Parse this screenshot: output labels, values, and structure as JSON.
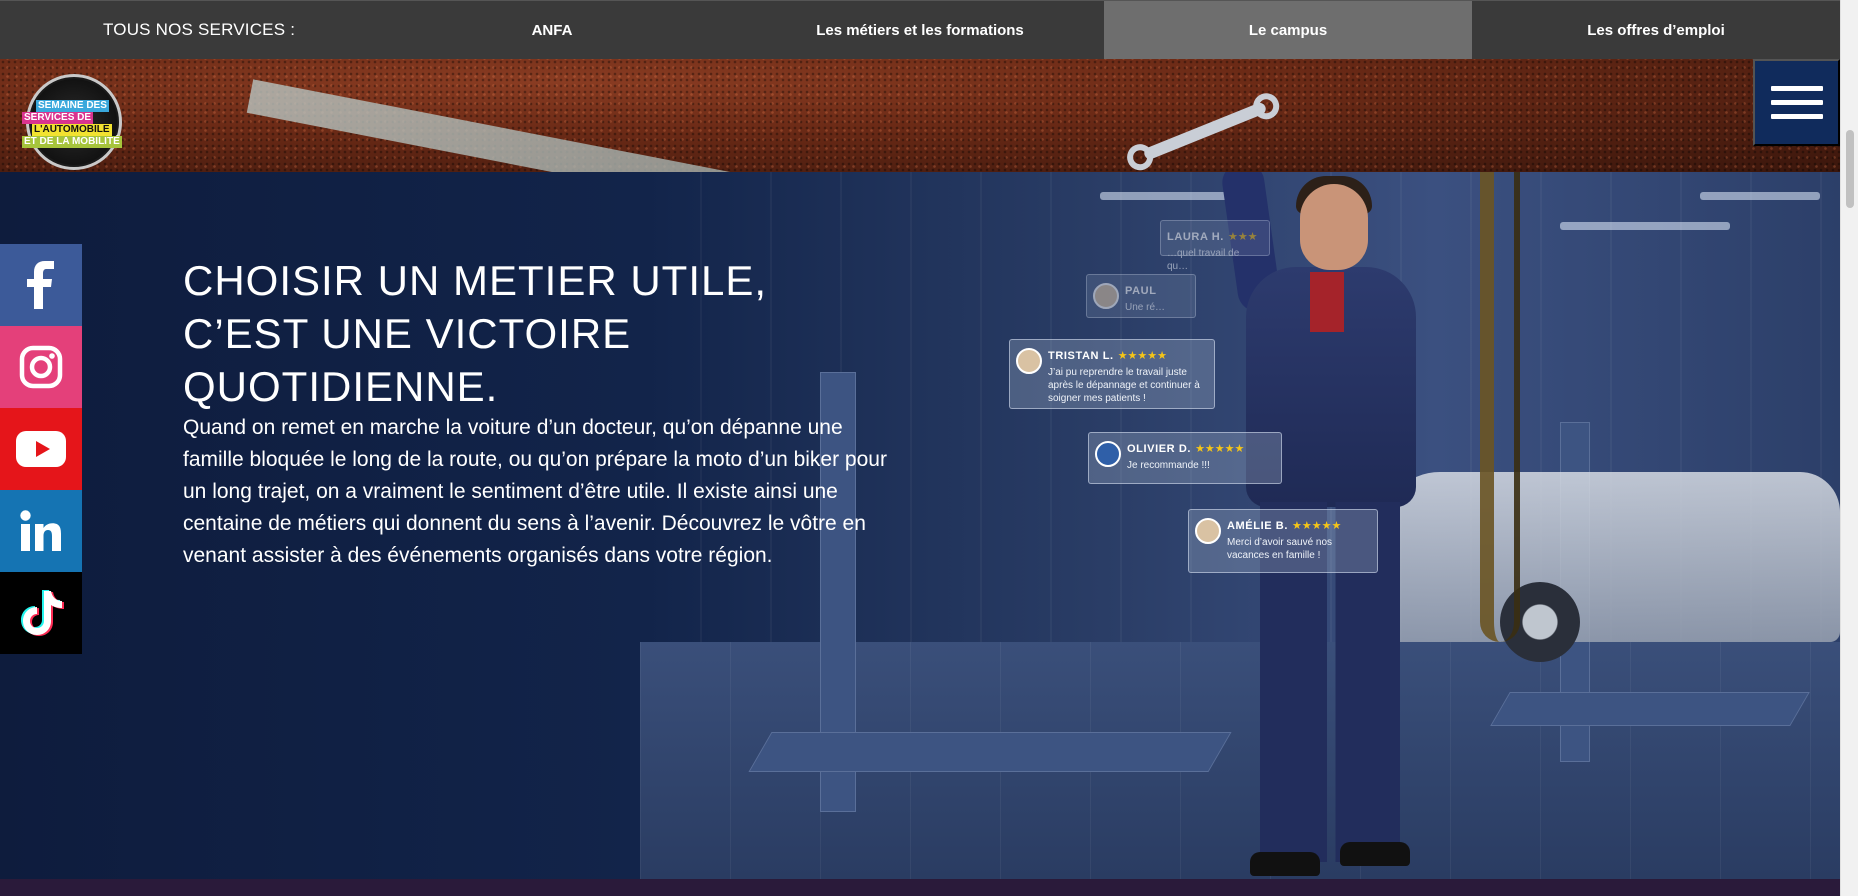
{
  "topbar": {
    "title": "TOUS NOS SERVICES :",
    "items": [
      {
        "label": "ANFA",
        "active": false
      },
      {
        "label": "Les métiers et les formations",
        "active": false
      },
      {
        "label": "Le campus",
        "active": true
      },
      {
        "label": "Les offres d’emploi",
        "active": false
      }
    ]
  },
  "logo": {
    "line1": "SEMAINE DES",
    "line2": "SERVICES DE",
    "line3": "L'AUTOMOBILE",
    "line4": "ET DE LA MOBILITÉ"
  },
  "menu": {
    "icon": "hamburger-menu-icon"
  },
  "hero": {
    "headline": "CHOISIR UN METIER UTILE, C’EST UNE VICTOIRE QUOTIDIENNE.",
    "body": "Quand on remet en marche la voiture d’un docteur, qu’on dépanne une famille bloquée le long de la route, ou qu’on prépare la moto d’un biker pour un long trajet, on a vraiment le sentiment d’être utile. Il existe ainsi une centaine de métiers qui donnent du sens à l’avenir. Découvrez le vôtre en venant assister à des événements organisés dans votre région."
  },
  "reviews": [
    {
      "name": "LAURA H.",
      "stars": "★★★",
      "text": "…quel travail de qu…"
    },
    {
      "name": "PAUL",
      "stars": "",
      "text": "Une ré…"
    },
    {
      "name": "TRISTAN  L.",
      "stars": "★★★★★",
      "text": "J’ai pu reprendre le travail juste après le dépannage et continuer à soigner mes patients !"
    },
    {
      "name": "OLIVIER  D.",
      "stars": "★★★★★",
      "text": "Je recommande !!!"
    },
    {
      "name": "AMÉLIE  B.",
      "stars": "★★★★★",
      "text": "Merci d’avoir sauvé nos vacances en famille !"
    }
  ],
  "social": [
    {
      "name": "facebook-icon",
      "color": "#3c5a99"
    },
    {
      "name": "instagram-icon",
      "color": "#e4407a"
    },
    {
      "name": "youtube-icon",
      "color": "#e5151a"
    },
    {
      "name": "linkedin-icon",
      "color": "#1574b3"
    },
    {
      "name": "tiktok-icon",
      "color": "#000000"
    }
  ],
  "colors": {
    "topbar_bg": "#3a3a3a",
    "topbar_active": "#6e6e6e",
    "menu_button_bg": "#102b5c",
    "hero_bg": "#0f1d3c",
    "star": "#f5c518"
  }
}
